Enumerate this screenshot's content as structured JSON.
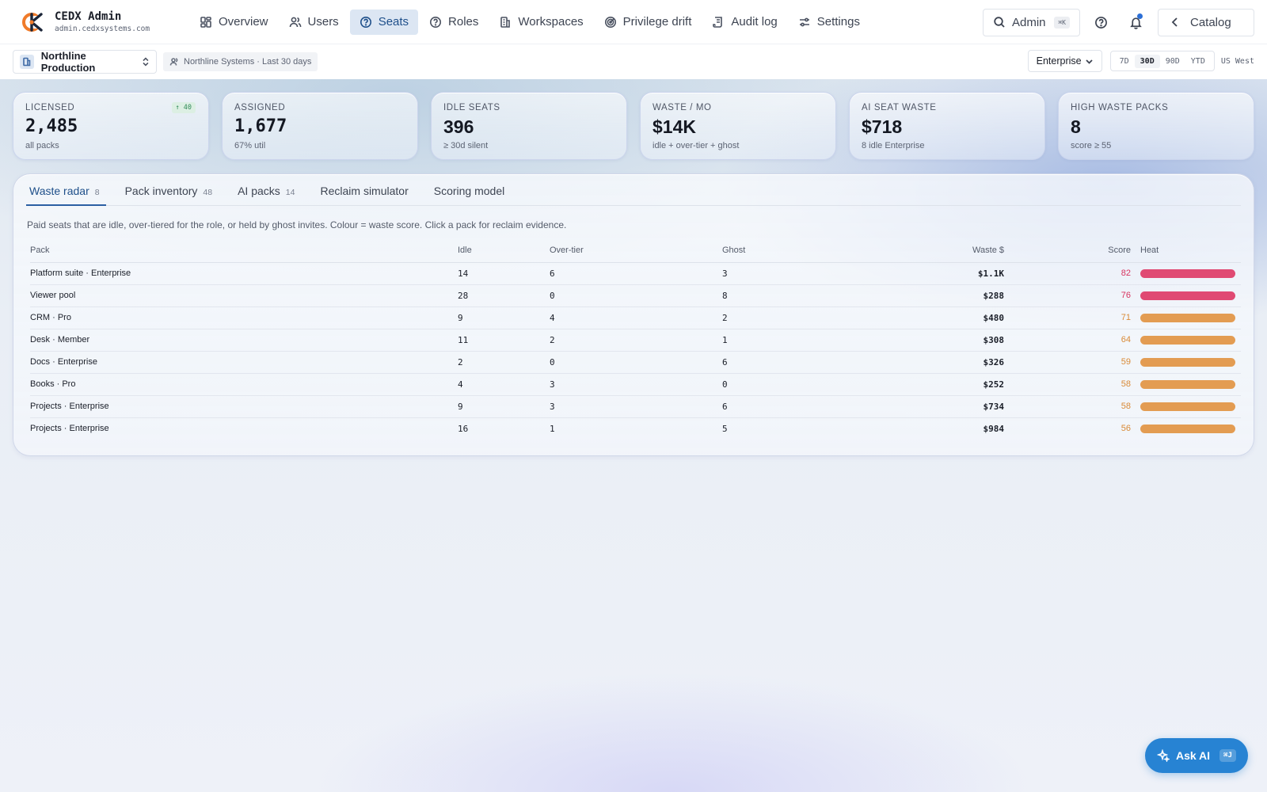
{
  "app": {
    "name": "CEDX Admin",
    "domain": "admin.cedxsystems.com"
  },
  "nav": {
    "items": [
      {
        "label": "Overview",
        "icon": "grid-icon"
      },
      {
        "label": "Users",
        "icon": "users-icon"
      },
      {
        "label": "Seats",
        "icon": "seat-icon"
      },
      {
        "label": "Roles",
        "icon": "help-circle-icon"
      },
      {
        "label": "Workspaces",
        "icon": "building-icon"
      },
      {
        "label": "Privilege drift",
        "icon": "radar-icon"
      },
      {
        "label": "Audit log",
        "icon": "scroll-icon"
      },
      {
        "label": "Settings",
        "icon": "sliders-icon"
      }
    ],
    "active": "Seats"
  },
  "top_right": {
    "search_label": "Admin",
    "search_kbd": "⌘K",
    "catalog_label": "Catalog"
  },
  "subbar": {
    "workspace": "Northline Production",
    "org_chip": "Northline Systems · Last 30 days",
    "tier": "Enterprise",
    "ranges": [
      "7D",
      "30D",
      "90D",
      "YTD"
    ],
    "active_range": "30D",
    "region": "US West"
  },
  "kpis": [
    {
      "label": "Licensed",
      "value": "2,485",
      "sub": "all packs",
      "delta": "↑ 40",
      "mono": true
    },
    {
      "label": "Assigned",
      "value": "1,677",
      "sub": "67% util",
      "mono": true
    },
    {
      "label": "Idle seats",
      "value": "396",
      "sub": "≥ 30d silent"
    },
    {
      "label": "Waste / mo",
      "value": "$14K",
      "sub": "idle + over-tier + ghost"
    },
    {
      "label": "AI seat waste",
      "value": "$718",
      "sub": "8 idle Enterprise"
    },
    {
      "label": "High waste packs",
      "value": "8",
      "sub": "score ≥ 55"
    }
  ],
  "tabs": [
    {
      "label": "Waste radar",
      "count": "8"
    },
    {
      "label": "Pack inventory",
      "count": "48"
    },
    {
      "label": "AI packs",
      "count": "14"
    },
    {
      "label": "Reclaim simulator",
      "count": ""
    },
    {
      "label": "Scoring model",
      "count": ""
    }
  ],
  "panel": {
    "description": "Paid seats that are idle, over-tiered for the role, or held by ghost invites. Colour = waste score. Click a pack for reclaim evidence.",
    "columns": [
      "Pack",
      "Idle",
      "Over-tier",
      "Ghost",
      "Waste $",
      "Score",
      "Heat"
    ],
    "rows": [
      {
        "pack": "Platform suite · Enterprise",
        "idle": "14",
        "over_tier": "6",
        "ghost": "3",
        "waste": "$1.1K",
        "score": "82",
        "level": "high"
      },
      {
        "pack": "Viewer pool",
        "idle": "28",
        "over_tier": "0",
        "ghost": "8",
        "waste": "$288",
        "score": "76",
        "level": "high"
      },
      {
        "pack": "CRM · Pro",
        "idle": "9",
        "over_tier": "4",
        "ghost": "2",
        "waste": "$480",
        "score": "71",
        "level": "mid"
      },
      {
        "pack": "Desk · Member",
        "idle": "11",
        "over_tier": "2",
        "ghost": "1",
        "waste": "$308",
        "score": "64",
        "level": "mid"
      },
      {
        "pack": "Docs · Enterprise",
        "idle": "2",
        "over_tier": "0",
        "ghost": "6",
        "waste": "$326",
        "score": "59",
        "level": "mid"
      },
      {
        "pack": "Books · Pro",
        "idle": "4",
        "over_tier": "3",
        "ghost": "0",
        "waste": "$252",
        "score": "58",
        "level": "mid"
      },
      {
        "pack": "Projects · Enterprise",
        "idle": "9",
        "over_tier": "3",
        "ghost": "6",
        "waste": "$734",
        "score": "58",
        "level": "mid"
      },
      {
        "pack": "Projects · Enterprise",
        "idle": "16",
        "over_tier": "1",
        "ghost": "5",
        "waste": "$984",
        "score": "56",
        "level": "mid"
      }
    ]
  },
  "colors": {
    "high": "#e04a73",
    "mid": "#e39c52",
    "high_text": "#d7335f",
    "mid_text": "#d98a37",
    "accent": "#1e4f8a"
  },
  "ask_ai": {
    "label": "Ask AI",
    "kbd": "⌘J"
  }
}
